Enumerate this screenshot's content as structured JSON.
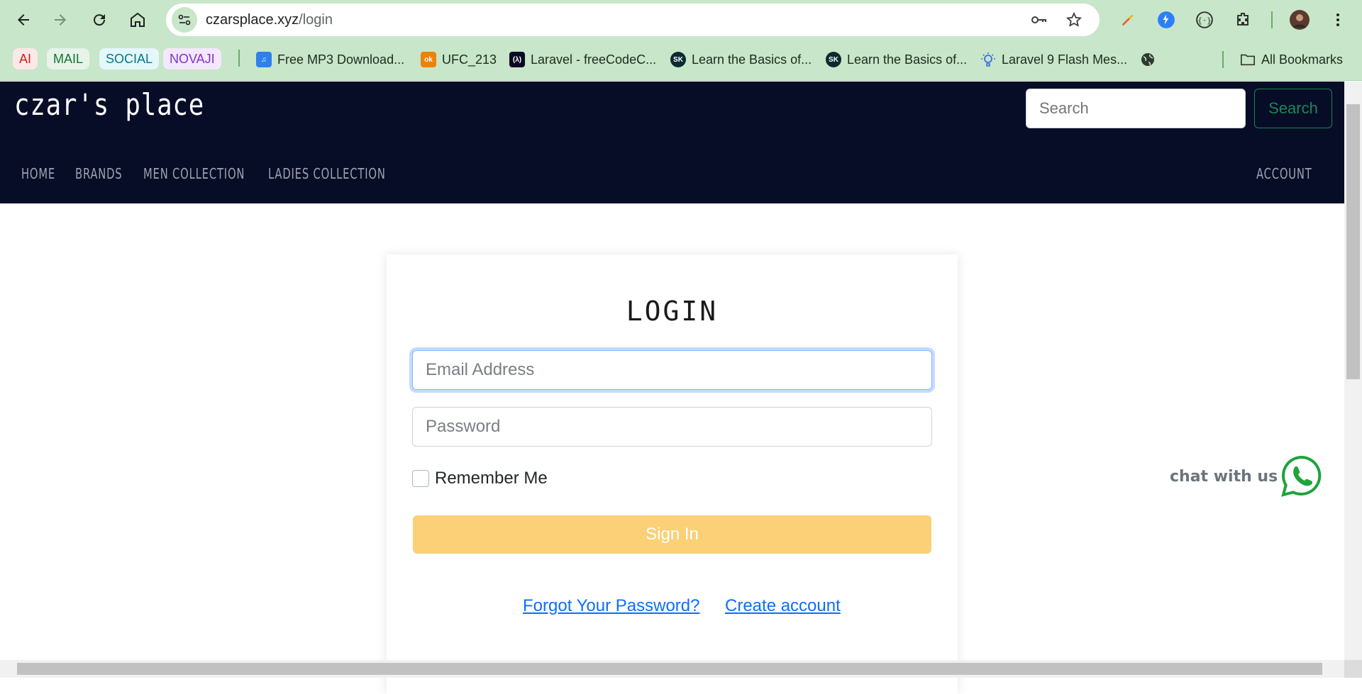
{
  "browser": {
    "url_host": "czarsplace.xyz",
    "url_path": "/login",
    "bookmark_chips": [
      {
        "label": "AI",
        "bg": "#fce8e6",
        "fg": "#c5221f"
      },
      {
        "label": "MAIL",
        "bg": "#e6f4ea",
        "fg": "#137333"
      },
      {
        "label": "SOCIAL",
        "bg": "#e4f7fb",
        "fg": "#007b83"
      },
      {
        "label": "NOVAJI",
        "bg": "#f3e8fd",
        "fg": "#8430ce"
      }
    ],
    "bookmarks": [
      {
        "label": "Free MP3 Download...",
        "icon": "music-icon"
      },
      {
        "label": "UFC_213",
        "icon": "odnoklassniki-icon"
      },
      {
        "label": "Laravel - freeCodeC...",
        "icon": "freecodecamp-icon"
      },
      {
        "label": "Learn the Basics of...",
        "icon": "sk-icon"
      },
      {
        "label": "Learn the Basics of...",
        "icon": "sk-icon"
      },
      {
        "label": "Laravel 9 Flash Mes...",
        "icon": "bulb-icon"
      }
    ],
    "all_bookmarks_label": "All Bookmarks"
  },
  "site": {
    "logo": "czar's place",
    "search_placeholder": "Search",
    "search_button": "Search",
    "menu": [
      "HOME",
      "BRANDS",
      "MEN COLLECTION",
      "LADIES COLLECTION"
    ],
    "account_label": "ACCOUNT"
  },
  "login": {
    "title": "LOGIN",
    "email_placeholder": "Email Address",
    "password_placeholder": "Password",
    "remember_label": "Remember Me",
    "signin_label": "Sign In",
    "forgot_label": "Forgot Your Password?",
    "create_label": "Create account"
  },
  "chat": {
    "label": "chat with us",
    "icon": "whatsapp-icon"
  },
  "colors": {
    "navbar_bg": "#070c27",
    "signin_bg": "#fbd077",
    "link": "#0d6efd",
    "search_accent": "#198754",
    "chrome_bg": "#c8e6c9"
  }
}
